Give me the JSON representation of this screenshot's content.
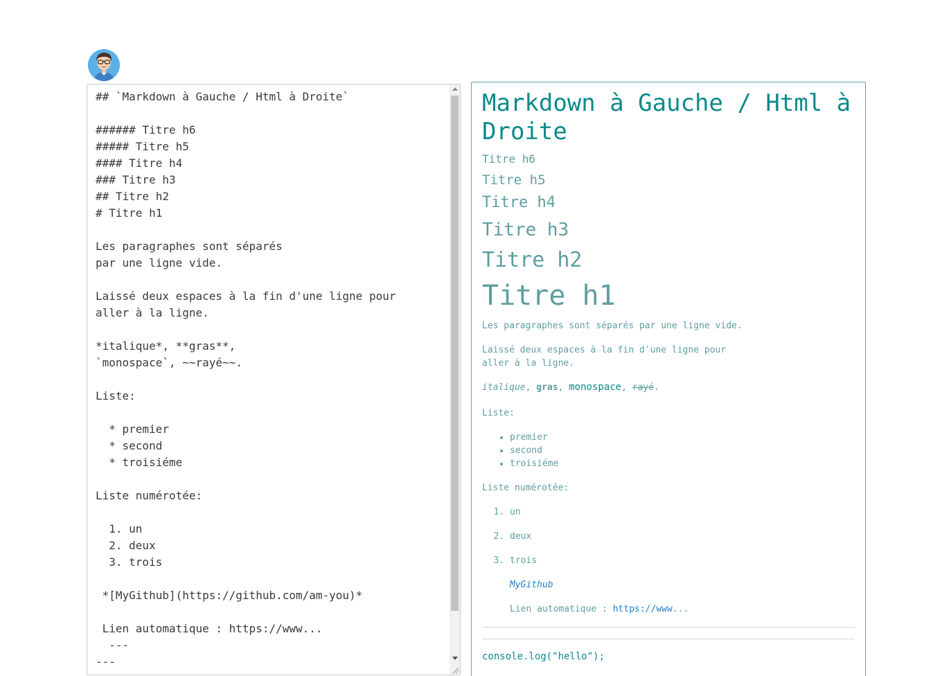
{
  "avatar": {
    "icon": "user-avatar-icon",
    "bg_color": "#5ab0e8"
  },
  "editor": {
    "text": "## `Markdown à Gauche / Html à Droite`\n\n###### Titre h6\n##### Titre h5\n#### Titre h4\n### Titre h3\n## Titre h2\n# Titre h1\n\nLes paragraphes sont séparés\npar une ligne vide.\n\nLaissé deux espaces à la fin d'une ligne pour\naller à la ligne.\n\n*italique*, **gras**,\n`monospace`, ~~rayé~~.\n\nListe:\n\n  * premier\n  * second\n  * troisiéme\n\nListe numérotée:\n\n  1. un\n  2. deux\n  3. trois\n\n *[MyGithub](https://github.com/am-you)*\n\n Lien automatique : https://www...\n  ---\n---"
  },
  "preview": {
    "title": "Markdown à Gauche / Html à Droite",
    "h6": "Titre h6",
    "h5": "Titre h5",
    "h4": "Titre h4",
    "h3": "Titre h3",
    "h2": "Titre h2",
    "h1": "Titre h1",
    "para1": "Les paragraphes sont séparés par une ligne vide.",
    "para2_line1": "Laissé deux espaces à la fin d'une ligne pour",
    "para2_line2": "aller à la ligne.",
    "inline": {
      "italic": "italique",
      "sep1": ", ",
      "bold": "gras",
      "sep2": ", ",
      "mono": "monospace",
      "sep3": ", ",
      "strike": "rayé",
      "end": "."
    },
    "list_label": "Liste:",
    "list_items": [
      "premier",
      "second",
      "troisiéme"
    ],
    "olist_label": "Liste numérotée:",
    "olist_items": [
      "un",
      "deux",
      "trois"
    ],
    "github_link": "MyGithub",
    "auto_link_label": "Lien automatique : ",
    "auto_link": "https://www",
    "auto_link_suffix": "...",
    "code": "console.log(\"hello\");"
  },
  "colors": {
    "heading": "#0b8a8a",
    "text": "#5f9ea0",
    "link": "#1e7fcf",
    "preview_border": "#5d9fb3"
  }
}
